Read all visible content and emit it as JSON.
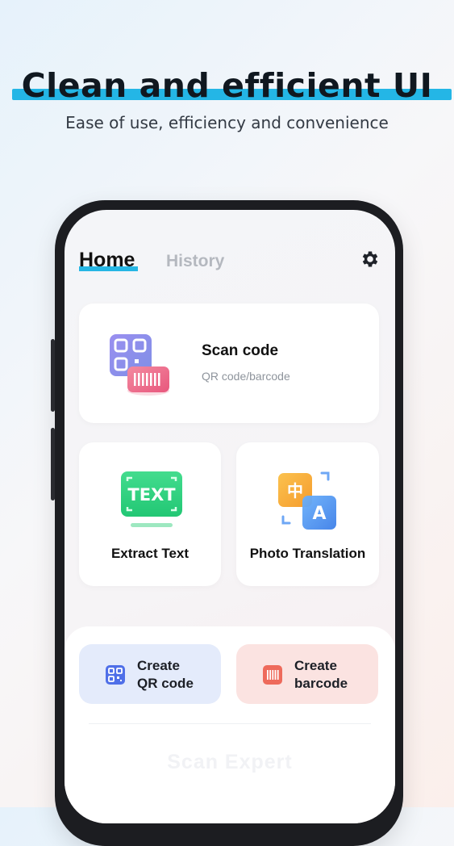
{
  "promo": {
    "headline": "Clean and efficient UI",
    "subtitle": "Ease of use, efficiency and convenience"
  },
  "nav": {
    "tabs": [
      {
        "label": "Home",
        "active": true
      },
      {
        "label": "History",
        "active": false
      }
    ],
    "settings_icon": "gear-icon"
  },
  "scan": {
    "title": "Scan code",
    "subtitle": "QR code/barcode",
    "icon": "qr-barcode-icon"
  },
  "features": [
    {
      "label": "Extract Text",
      "icon": "text-recognition-icon",
      "icon_text": "TEXT"
    },
    {
      "label": "Photo Translation",
      "icon": "translate-icon",
      "glyph_a": "中",
      "glyph_b": "A"
    }
  ],
  "create": [
    {
      "label": "Create QR code",
      "icon": "qr-code-icon",
      "color": "#e4ebfb"
    },
    {
      "label": "Create barcode",
      "icon": "barcode-icon",
      "color": "#fbe3e1"
    }
  ],
  "brand": "Scan Expert",
  "colors": {
    "accent": "#26b6e4",
    "qr_purple": "#8a86e8",
    "barcode_pink": "#ef6f8e",
    "text_green": "#2fd182",
    "translate_orange": "#f7a636",
    "translate_blue": "#4a8df0"
  }
}
